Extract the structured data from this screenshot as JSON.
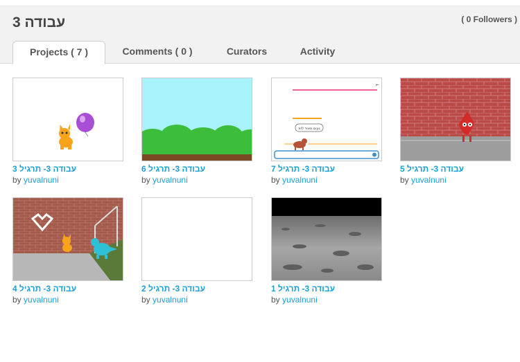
{
  "studio": {
    "title": "עבודה 3",
    "followers": "( 0 Followers )"
  },
  "tabs": [
    {
      "label": "Projects ( 7 )",
      "active": true
    },
    {
      "label": "Comments ( 0 )",
      "active": false
    },
    {
      "label": "Curators",
      "active": false
    },
    {
      "label": "Activity",
      "active": false
    }
  ],
  "by_label": "by",
  "projects": [
    {
      "title": "עבודה 3- תרגיל 3",
      "author": "yuvalnuni"
    },
    {
      "title": "עבודה 3- תרגיל 6",
      "author": "yuvalnuni"
    },
    {
      "title": "עבודה 3- תרגיל 7",
      "author": "yuvalnuni"
    },
    {
      "title": "עבודה 3- תרגיל 5",
      "author": "yuvalnuni"
    },
    {
      "title": "עבודה 3- תרגיל 4",
      "author": "yuvalnuni"
    },
    {
      "title": "עבודה 3- תרגיל 2",
      "author": "yuvalnuni"
    },
    {
      "title": "עבודה 3- תרגיל 1",
      "author": "yuvalnuni"
    }
  ],
  "speech_bubble_text": "נעים מאוד לזוז"
}
